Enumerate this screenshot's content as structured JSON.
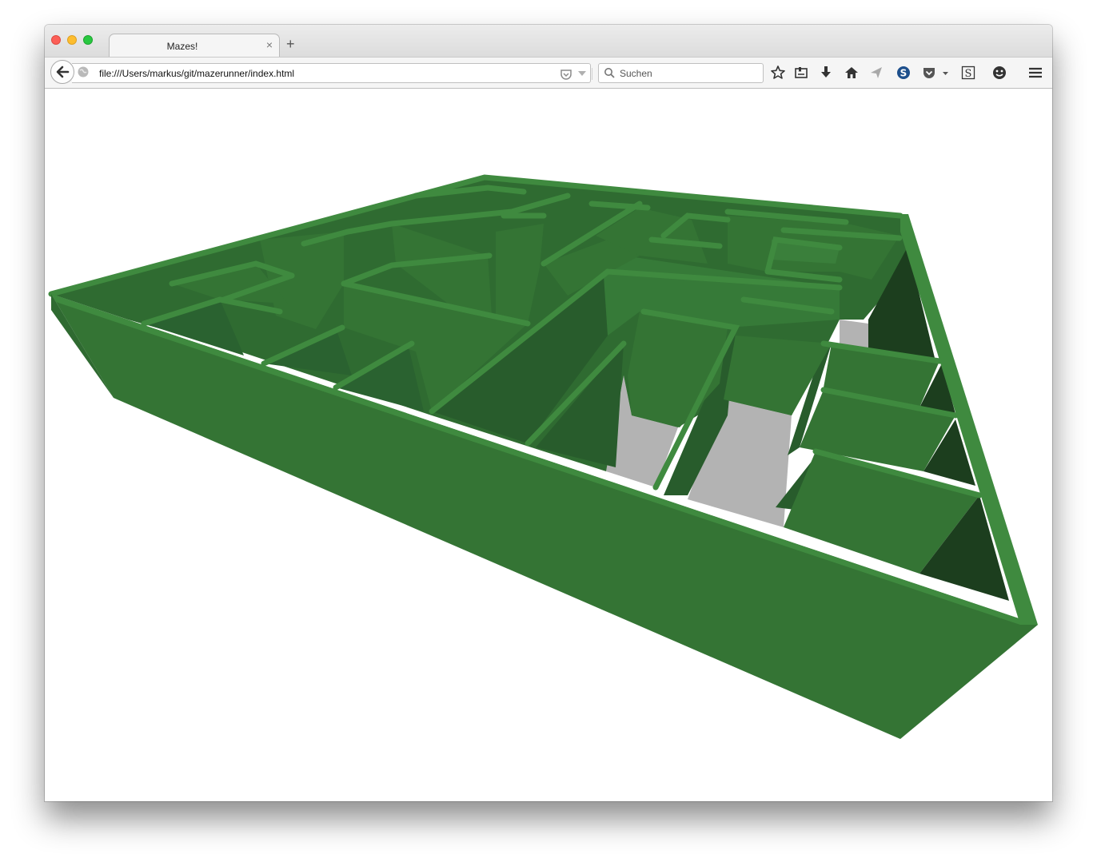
{
  "window": {
    "tab_title": "Mazes!",
    "tab_close": "×",
    "new_tab": "+"
  },
  "navbar": {
    "url": "file:///Users/markus/git/mazerunner/index.html",
    "search_placeholder": "Suchen"
  },
  "icons": [
    "back-arrow-icon",
    "globe-icon",
    "pocket-icon",
    "dropmarker-icon",
    "reload-icon",
    "search-icon",
    "bookmark-star-icon",
    "reading-list-icon",
    "download-icon",
    "home-icon",
    "send-icon",
    "skype-icon",
    "pocket-icon",
    "ext-s-icon",
    "chat-icon",
    "menu-icon"
  ],
  "colors": {
    "wall_top": "#3f8a3f",
    "wall_face": "#347434",
    "wall_side": "#285c2c",
    "wall_shadow": "#1c3e1e",
    "floor": "#b3b3b3"
  }
}
